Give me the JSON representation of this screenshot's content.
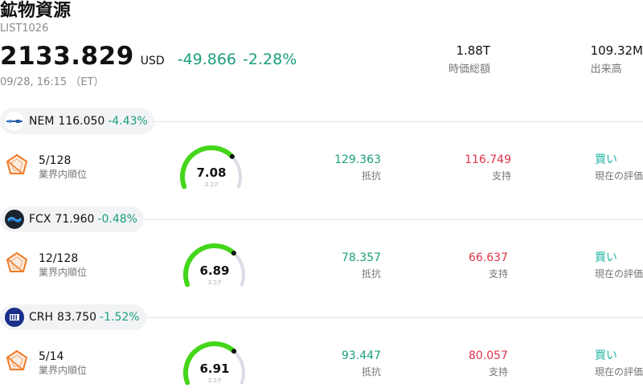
{
  "header": {
    "title": "鉱物資源",
    "ticker": "LIST1026",
    "price": "2133.829",
    "currency": "USD",
    "change": "-49.866",
    "change_pct": "-2.28%",
    "timestamp": "09/28, 16:15 （ET）",
    "market_cap": {
      "value": "1.88T",
      "label": "時価総額"
    },
    "volume": {
      "value": "109.32M",
      "label": "出来高"
    }
  },
  "labels": {
    "rank": "業界内順位",
    "score": "スコア",
    "resistance": "抵抗",
    "support": "支持",
    "rating": "現在の評価"
  },
  "colors": {
    "positive_change": "#1a9e7e",
    "support": "#e0334a",
    "rating": "#1fb6a3",
    "gauge_fill": "#44d61a",
    "gauge_track": "#dcdce6"
  },
  "stocks": [
    {
      "symbol": "NEM",
      "price": "116.050",
      "change_pct": "-4.43%",
      "logo": "newmont-logo",
      "rank": "5/128",
      "score": "7.08",
      "score_value": 7.08,
      "resistance": "129.363",
      "support": "116.749",
      "rating": "買い"
    },
    {
      "symbol": "FCX",
      "price": "71.960",
      "change_pct": "-0.48%",
      "logo": "freeport-logo",
      "rank": "12/128",
      "score": "6.89",
      "score_value": 6.89,
      "resistance": "78.357",
      "support": "66.637",
      "rating": "買い"
    },
    {
      "symbol": "CRH",
      "price": "83.750",
      "change_pct": "-1.52%",
      "logo": "crh-logo",
      "rank": "5/14",
      "score": "6.91",
      "score_value": 6.91,
      "resistance": "93.447",
      "support": "80.057",
      "rating": "買い"
    }
  ]
}
